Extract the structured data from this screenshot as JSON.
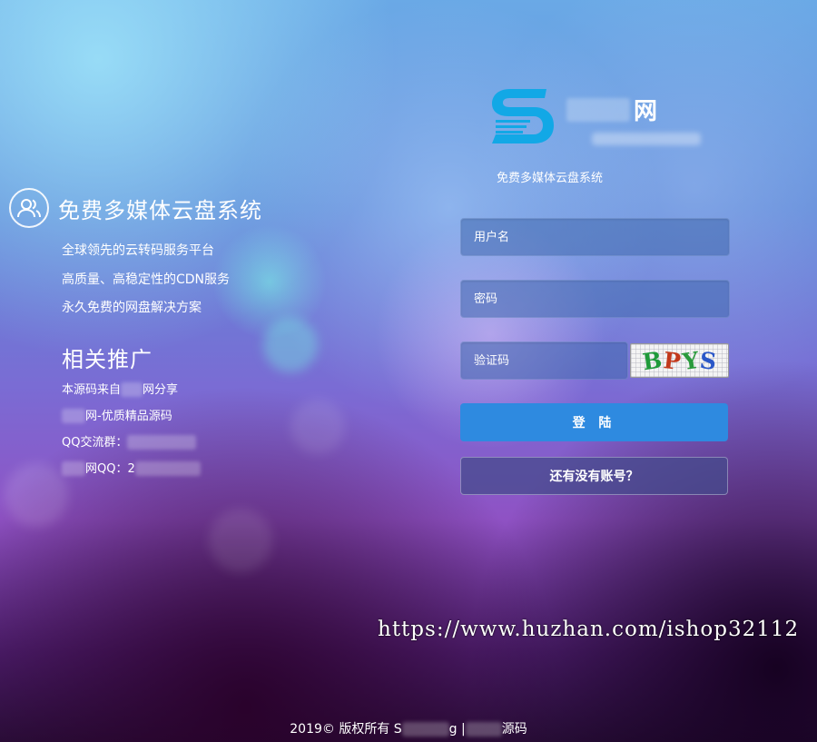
{
  "site": {
    "logo_text": "网",
    "slogan": "免费多媒体云盘系统"
  },
  "left": {
    "title": "免费多媒体云盘系统",
    "features": [
      "全球领先的云转码服务平台",
      "高质量、高稳定性的CDN服务",
      "永久免费的网盘解决方案"
    ],
    "promo_title": "相关推广",
    "promo": {
      "line1_a": "本源码来自",
      "line1_b": "网分享",
      "line2": "网-优质精品源码",
      "line3": "QQ交流群：",
      "line4": "网QQ：2"
    }
  },
  "form": {
    "username_placeholder": "用户名",
    "password_placeholder": "密码",
    "captcha_placeholder": "验证码",
    "captcha_chars": [
      {
        "ch": "B",
        "color": "#1f9a3a"
      },
      {
        "ch": "P",
        "color": "#c2391c"
      },
      {
        "ch": "Y",
        "color": "#2a9a3c"
      },
      {
        "ch": "S",
        "color": "#2a57c8"
      }
    ],
    "login_label": "登 陆",
    "register_label": "还有没有账号？"
  },
  "watermark": "https://www.huzhan.com/ishop32112",
  "footer": {
    "left": "2019© 版权所有 S",
    "mid": "g |",
    "right": "源码"
  },
  "colors": {
    "login_button": "#2e8ae0",
    "logo_blue": "#12a8e6"
  }
}
